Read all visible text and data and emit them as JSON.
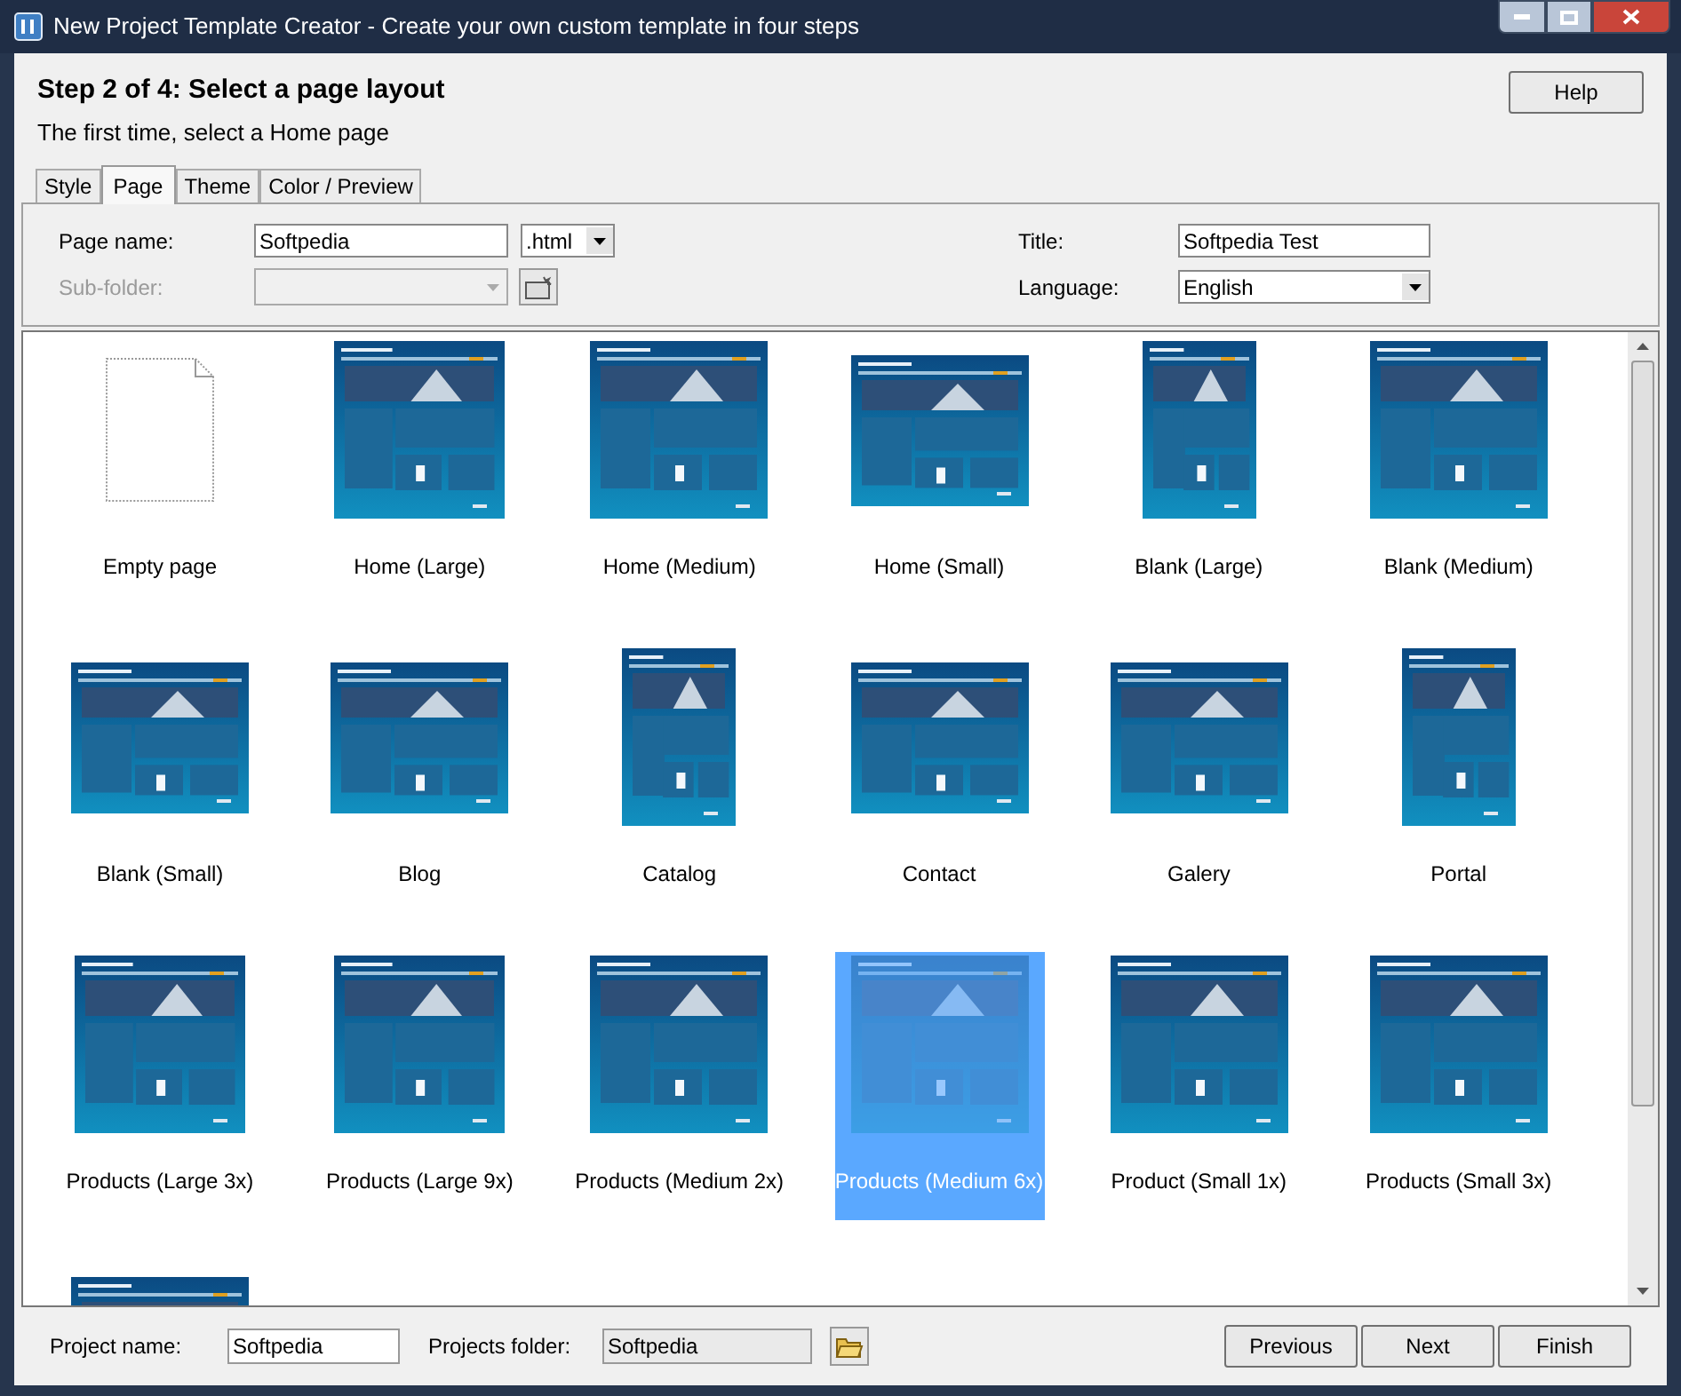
{
  "window": {
    "title": "New Project Template Creator - Create your own custom template in four steps"
  },
  "header": {
    "heading": "Step 2 of 4: Select a page layout",
    "subtitle": "The first time, select a Home page",
    "help_button": "Help"
  },
  "tabs": [
    {
      "label": "Style",
      "selected": false
    },
    {
      "label": "Page",
      "selected": true
    },
    {
      "label": "Theme",
      "selected": false
    },
    {
      "label": "Color / Preview",
      "selected": false
    }
  ],
  "form": {
    "page_name": {
      "label": "Page name:",
      "value": "Softpedia"
    },
    "extension": {
      "value": ".html"
    },
    "sub_folder": {
      "label": "Sub-folder:",
      "disabled": true
    },
    "title": {
      "label": "Title:",
      "value": "Softpedia Test"
    },
    "language": {
      "label": "Language:",
      "value": "English"
    }
  },
  "layouts": [
    {
      "label": "Empty page",
      "kind": "empty",
      "selected": false
    },
    {
      "label": "Home (Large)",
      "kind": "portrait",
      "selected": false
    },
    {
      "label": "Home (Medium)",
      "kind": "square",
      "selected": false
    },
    {
      "label": "Home (Small)",
      "kind": "wide",
      "selected": false
    },
    {
      "label": "Blank (Large)",
      "kind": "narrow",
      "selected": false
    },
    {
      "label": "Blank (Medium)",
      "kind": "square",
      "selected": false
    },
    {
      "label": "Blank (Small)",
      "kind": "wide",
      "selected": false
    },
    {
      "label": "Blog",
      "kind": "wide",
      "selected": false
    },
    {
      "label": "Catalog",
      "kind": "narrow",
      "selected": false
    },
    {
      "label": "Contact",
      "kind": "wide",
      "selected": false
    },
    {
      "label": "Galery",
      "kind": "wide",
      "selected": false
    },
    {
      "label": "Portal",
      "kind": "narrow",
      "selected": false
    },
    {
      "label": "Products (Large 3x)",
      "kind": "portrait",
      "selected": false
    },
    {
      "label": "Products (Large 9x)",
      "kind": "portrait",
      "selected": false
    },
    {
      "label": "Products (Medium 2x)",
      "kind": "square",
      "selected": false
    },
    {
      "label": "Products (Medium 6x)",
      "kind": "square",
      "selected": true
    },
    {
      "label": "Product (Small 1x)",
      "kind": "square",
      "selected": false
    },
    {
      "label": "Products (Small 3x)",
      "kind": "square",
      "selected": false
    },
    {
      "kind": "wide",
      "selected": false
    }
  ],
  "footer": {
    "project_name": {
      "label": "Project name:",
      "value": "Softpedia"
    },
    "projects_folder": {
      "label": "Projects folder:",
      "value": "Softpedia"
    },
    "buttons": [
      {
        "label": "Previous"
      },
      {
        "label": "Next"
      },
      {
        "label": "Finish"
      }
    ]
  }
}
